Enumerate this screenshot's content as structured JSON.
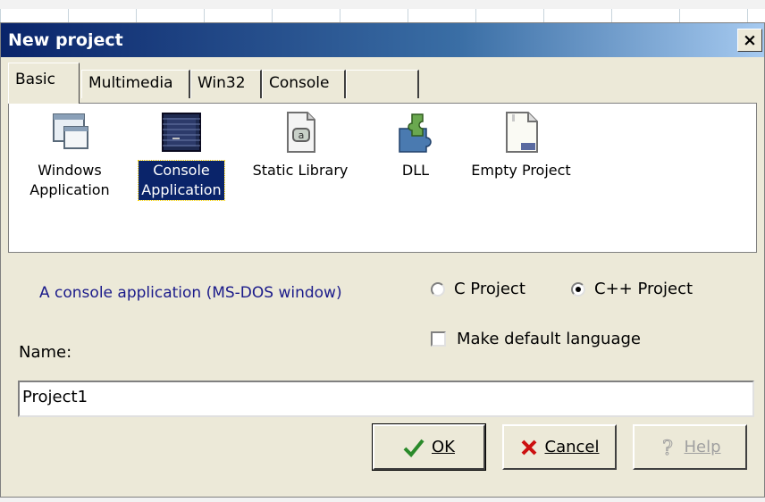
{
  "window": {
    "title": "New project",
    "close_glyph": "×"
  },
  "tabs": [
    {
      "label": "Basic",
      "active": true
    },
    {
      "label": "Multimedia",
      "active": false
    },
    {
      "label": "Win32",
      "active": false
    },
    {
      "label": "Console",
      "active": false
    },
    {
      "label": "",
      "active": false
    }
  ],
  "templates": [
    {
      "label_line1": "Windows",
      "label_line2": "Application",
      "icon": "window-icon",
      "selected": false
    },
    {
      "label_line1": "Console",
      "label_line2": "Application",
      "icon": "console-icon",
      "selected": true
    },
    {
      "label_line1": "Static Library",
      "label_line2": "",
      "icon": "library-icon",
      "selected": false
    },
    {
      "label_line1": "DLL",
      "label_line2": "",
      "icon": "puzzle-icon",
      "selected": false
    },
    {
      "label_line1": "Empty Project",
      "label_line2": "",
      "icon": "empty-document-icon",
      "selected": false
    }
  ],
  "description": "A console application (MS-DOS window)",
  "language": {
    "c_label": "C Project",
    "cpp_label": "C++ Project",
    "selected": "cpp",
    "default_label": "Make default language",
    "make_default": false
  },
  "name": {
    "label": "Name:",
    "value": "Project1"
  },
  "buttons": {
    "ok": "OK",
    "cancel": "Cancel",
    "help": "Help"
  },
  "colors": {
    "title_bar_start": "#0a246a",
    "title_bar_end": "#a6caf0",
    "dialog_face": "#ece9d8",
    "selection": "#0a246a",
    "description_text": "#1a1a8a",
    "ok_check": "#2a8a2a",
    "cancel_x": "#cc1010"
  }
}
